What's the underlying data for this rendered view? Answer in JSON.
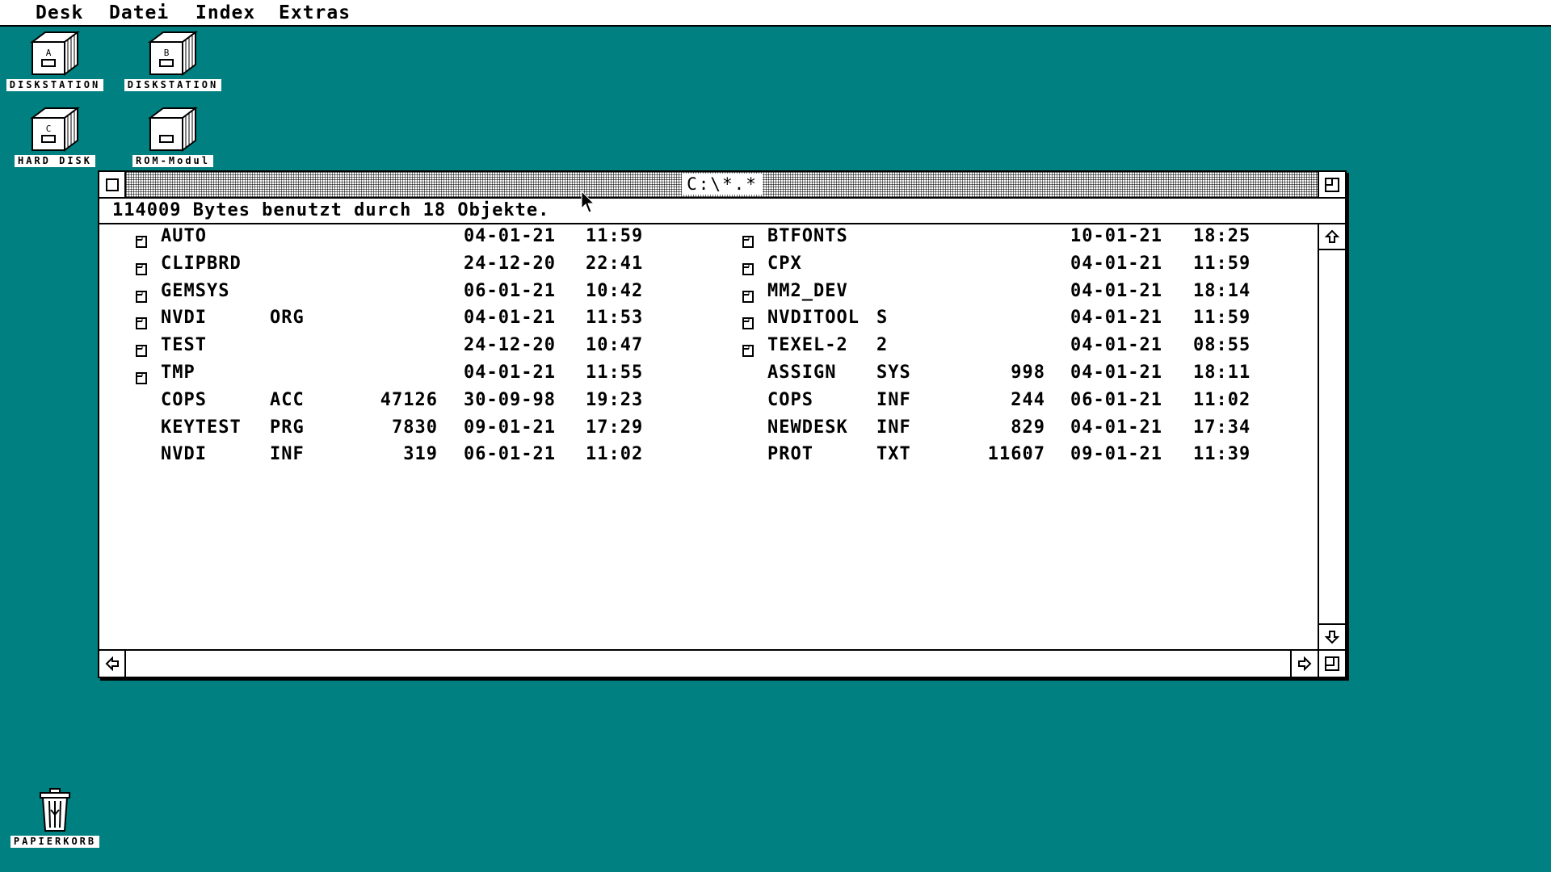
{
  "menubar": {
    "items": [
      "Desk",
      "Datei",
      "Index",
      "Extras"
    ]
  },
  "desktop_icons": [
    {
      "name": "diskstation-a",
      "drive": "A",
      "label": "DISKSTATION"
    },
    {
      "name": "diskstation-b",
      "drive": "B",
      "label": "DISKSTATION"
    },
    {
      "name": "hard-disk-c",
      "drive": "C",
      "label": "HARD DISK"
    },
    {
      "name": "rom-modul",
      "drive": "",
      "label": "ROM-Modul"
    }
  ],
  "trash": {
    "label": "PAPIERKORB"
  },
  "window": {
    "title": "C:\\*.*",
    "info": "114009 Bytes benutzt durch 18 Objekte.",
    "left_column": [
      {
        "folder": true,
        "name": "AUTO",
        "ext": "",
        "size": "",
        "date": "04-01-21",
        "time": "11:59"
      },
      {
        "folder": true,
        "name": "CLIPBRD",
        "ext": "",
        "size": "",
        "date": "24-12-20",
        "time": "22:41"
      },
      {
        "folder": true,
        "name": "GEMSYS",
        "ext": "",
        "size": "",
        "date": "06-01-21",
        "time": "10:42"
      },
      {
        "folder": true,
        "name": "NVDI",
        "ext": "ORG",
        "size": "",
        "date": "04-01-21",
        "time": "11:53"
      },
      {
        "folder": true,
        "name": "TEST",
        "ext": "",
        "size": "",
        "date": "24-12-20",
        "time": "10:47"
      },
      {
        "folder": true,
        "name": "TMP",
        "ext": "",
        "size": "",
        "date": "04-01-21",
        "time": "11:55"
      },
      {
        "folder": false,
        "name": "COPS",
        "ext": "ACC",
        "size": "47126",
        "date": "30-09-98",
        "time": "19:23"
      },
      {
        "folder": false,
        "name": "KEYTEST",
        "ext": "PRG",
        "size": "7830",
        "date": "09-01-21",
        "time": "17:29"
      },
      {
        "folder": false,
        "name": "NVDI",
        "ext": "INF",
        "size": "319",
        "date": "06-01-21",
        "time": "11:02"
      }
    ],
    "right_column": [
      {
        "folder": true,
        "name": "BTFONTS",
        "ext": "",
        "size": "",
        "date": "10-01-21",
        "time": "18:25"
      },
      {
        "folder": true,
        "name": "CPX",
        "ext": "",
        "size": "",
        "date": "04-01-21",
        "time": "11:59"
      },
      {
        "folder": true,
        "name": "MM2_DEV",
        "ext": "",
        "size": "",
        "date": "04-01-21",
        "time": "18:14"
      },
      {
        "folder": true,
        "name": "NVDITOOL",
        "ext": "S",
        "size": "",
        "date": "04-01-21",
        "time": "11:59"
      },
      {
        "folder": true,
        "name": "TEXEL-2",
        "ext": "2",
        "size": "",
        "date": "04-01-21",
        "time": "08:55"
      },
      {
        "folder": false,
        "name": "ASSIGN",
        "ext": "SYS",
        "size": "998",
        "date": "04-01-21",
        "time": "18:11"
      },
      {
        "folder": false,
        "name": "COPS",
        "ext": "INF",
        "size": "244",
        "date": "06-01-21",
        "time": "11:02"
      },
      {
        "folder": false,
        "name": "NEWDESK",
        "ext": "INF",
        "size": "829",
        "date": "04-01-21",
        "time": "17:34"
      },
      {
        "folder": false,
        "name": "PROT",
        "ext": "TXT",
        "size": "11607",
        "date": "09-01-21",
        "time": "11:39"
      }
    ]
  },
  "icons": {
    "close": "close-icon",
    "fuller": "fuller-icon",
    "up": "arrow-up-icon",
    "down": "arrow-down-icon",
    "left": "arrow-left-icon",
    "right": "arrow-right-icon",
    "sizer": "sizer-icon",
    "folder": "folder-icon",
    "cursor": "mouse-pointer-icon"
  },
  "colors": {
    "desktop": "#008080",
    "window": "#ffffff",
    "text": "#000000"
  }
}
